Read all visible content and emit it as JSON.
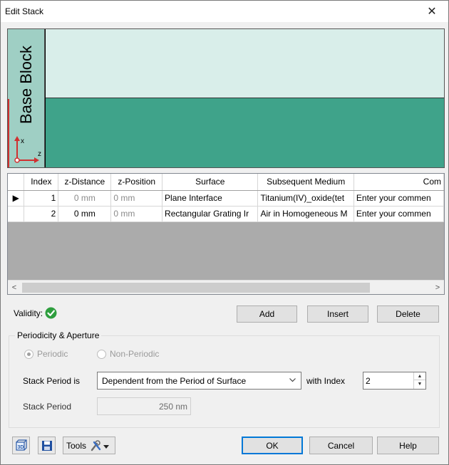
{
  "window": {
    "title": "Edit Stack",
    "close_glyph": "✕"
  },
  "preview": {
    "base_block_label": "Base Block",
    "axis_x": "x",
    "axis_z": "z"
  },
  "grid": {
    "columns": [
      "",
      "Index",
      "z-Distance",
      "z-Position",
      "Surface",
      "Subsequent Medium",
      "Com"
    ],
    "rows": [
      {
        "marker": "▶",
        "index": "1",
        "z_distance": "0 mm",
        "z_position": "0 mm",
        "surface": "Plane Interface",
        "medium": "Titanium(IV)_oxide(tet",
        "comment": "Enter your commen"
      },
      {
        "marker": "",
        "index": "2",
        "z_distance": "0 mm",
        "z_position": "0 mm",
        "surface": "Rectangular Grating Ir",
        "medium": "Air in Homogeneous M",
        "comment": "Enter your commen"
      }
    ],
    "scroll_left": "<",
    "scroll_right": ">"
  },
  "validity": {
    "label": "Validity:",
    "status": "valid",
    "color": "#2e9e3e"
  },
  "actions": {
    "add": "Add",
    "insert": "Insert",
    "delete": "Delete"
  },
  "periodicity": {
    "group_title": "Periodicity & Aperture",
    "periodic_label": "Periodic",
    "non_periodic_label": "Non-Periodic",
    "selected": "Periodic",
    "stack_period_is_label": "Stack Period is",
    "stack_period_mode": "Dependent from the Period of Surface",
    "with_index_label": "with Index",
    "with_index_value": "2",
    "stack_period_label": "Stack Period",
    "stack_period_value": "250 nm"
  },
  "footer": {
    "tools_label": "Tools",
    "ok": "OK",
    "cancel": "Cancel",
    "help": "Help"
  }
}
